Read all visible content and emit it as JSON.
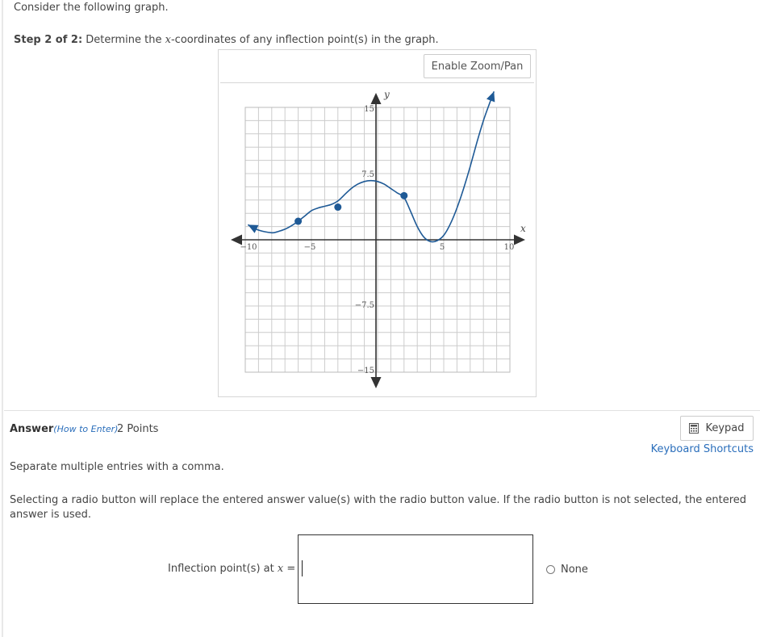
{
  "intro": "Consider the following graph.",
  "step": {
    "label": "Step 2 of 2:",
    "text_pre": "Determine the ",
    "variable": "x",
    "text_post": "-coordinates of any inflection point(s) in the graph."
  },
  "graph": {
    "zoom_button": "Enable Zoom/Pan",
    "x_axis_label": "x",
    "y_axis_label": "y",
    "x_ticks": [
      "−10",
      "−5",
      "5",
      "10"
    ],
    "y_ticks": [
      "15",
      "7.5",
      "−7.5",
      "−15"
    ],
    "curve_color": "#1f5a96",
    "grid_color": "#cccccc"
  },
  "chart_data": {
    "type": "line",
    "title": "",
    "xlabel": "x",
    "ylabel": "y",
    "xlim": [
      -10,
      10
    ],
    "ylim": [
      -15,
      15
    ],
    "x_ticks": [
      -10,
      -5,
      5,
      10
    ],
    "y_ticks": [
      -15,
      -7.5,
      7.5,
      15
    ],
    "grid": true,
    "series": [
      {
        "x": [
          -9.8,
          -9,
          -8,
          -7.6,
          -7,
          -6.5,
          -6,
          -5.5,
          -5,
          -4.5,
          -4,
          -3.5,
          -3,
          -2.5,
          -2,
          -1.5,
          -1,
          -0.5,
          0,
          0.5,
          1,
          1.5,
          2,
          2.5,
          3,
          3.5,
          4,
          4.5,
          5,
          5.5,
          6,
          6.5,
          7,
          7.5,
          8,
          8.5,
          8.8
        ],
        "y": [
          1.7,
          1.1,
          0.8,
          0.9,
          1.2,
          1.6,
          2.1,
          2.7,
          3.3,
          3.6,
          3.8,
          4.0,
          4.4,
          5.1,
          5.8,
          6.3,
          6.6,
          6.7,
          6.6,
          6.3,
          5.8,
          5.3,
          4.8,
          3.2,
          1.5,
          0.3,
          -0.2,
          -0.1,
          0.5,
          1.8,
          3.6,
          5.8,
          8.3,
          11.0,
          13.5,
          15.6,
          16.8
        ]
      }
    ],
    "closed_points": [
      [
        -6,
        2.1
      ],
      [
        -3,
        3.7
      ],
      [
        2,
        5.0
      ]
    ],
    "arrows": [
      "left",
      "right"
    ]
  },
  "answer": {
    "label": "Answer",
    "how_to": "(How to Enter)",
    "points": "2 Points",
    "keypad": "Keypad",
    "keyboard_shortcuts": "Keyboard Shortcuts",
    "separate_note": "Separate multiple entries with a comma.",
    "radio_note": "Selecting a radio button will replace the entered answer value(s) with the radio button value. If the radio button is not selected, the entered answer is used.",
    "inflection_label_pre": "Inflection point(s) at ",
    "inflection_var": "x",
    "inflection_eq": " =",
    "input_value": "",
    "none_option": "None"
  }
}
